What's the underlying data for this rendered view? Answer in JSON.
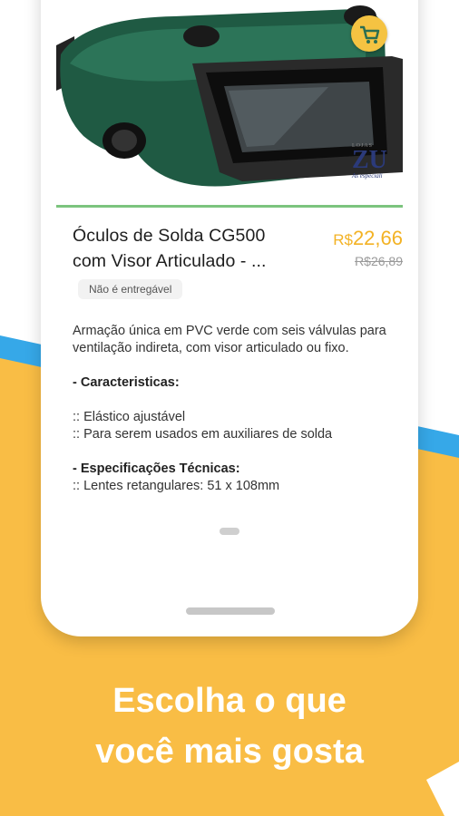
{
  "colors": {
    "background_yellow": "#f9bd45",
    "accent_blue": "#36a8e8",
    "price": "#f3b224",
    "divider_green": "#7cc47e"
  },
  "product": {
    "title": "Óculos de Solda CG500 com Visor Articulado - ...",
    "price_currency": "R$",
    "price_value": "22,66",
    "old_price": "R$26,89",
    "delivery_badge": "Não é entregável",
    "image_icon": "welding-goggles-image",
    "store_logo_text": "ZU",
    "store_logo_small": "LOJAS",
    "store_logo_sub": "As especiali"
  },
  "cart_button_icon": "cart-icon",
  "description": {
    "intro": "Armação única em PVC verde com seis válvulas para ventilação indireta, com visor articulado ou fixo.",
    "characteristics_heading": "- Caracteristicas:",
    "characteristics": [
      ":: Elástico ajustável",
      ":: Para serem usados em auxiliares de solda"
    ],
    "specs_heading": "- Especificações Técnicas:",
    "specs": [
      ":: Lentes retangulares: 51 x 108mm"
    ]
  },
  "tagline": {
    "line1": "Escolha o que",
    "line2": "você mais gosta"
  }
}
